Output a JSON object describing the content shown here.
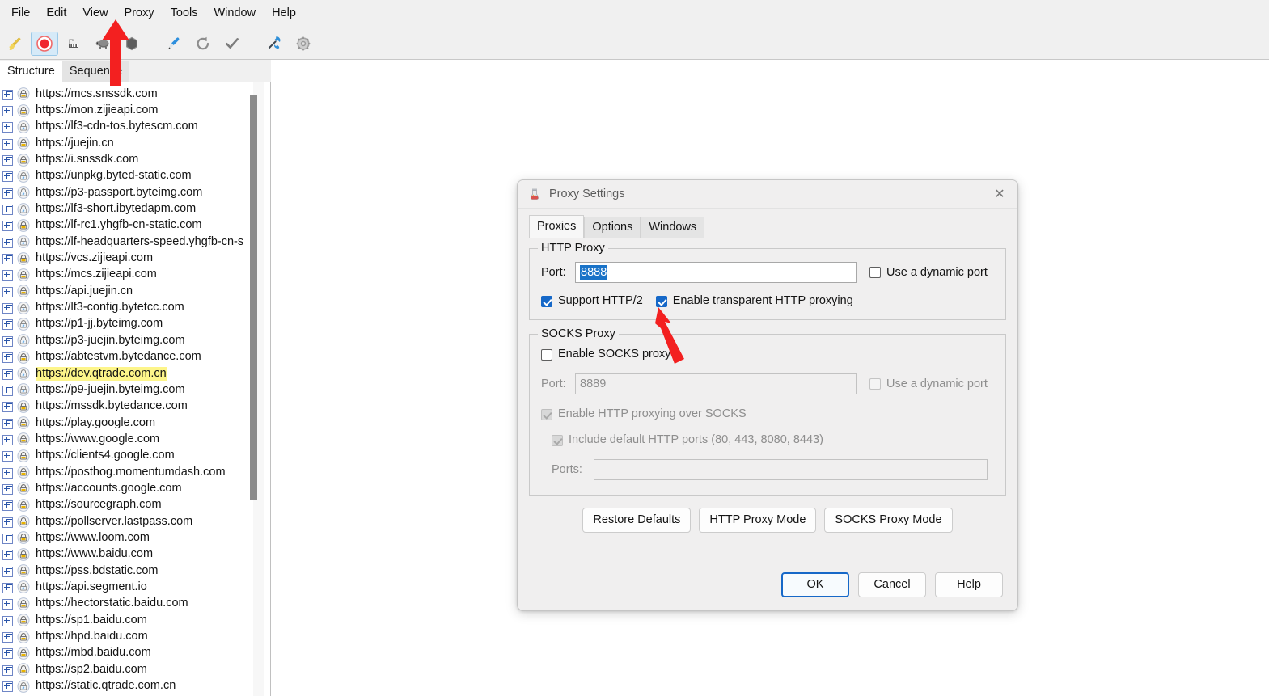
{
  "app": {
    "menubar": [
      "File",
      "Edit",
      "View",
      "Proxy",
      "Tools",
      "Window",
      "Help"
    ],
    "toolbar_icons": [
      "broom-clear-icon",
      "record-icon",
      "breakpoint-icon",
      "throttle-turtle-icon",
      "stop-hexagon-icon",
      "compose-pen-icon",
      "repeat-refresh-icon",
      "validate-check-icon",
      "tools-icon",
      "settings-gear-icon"
    ]
  },
  "left_panel": {
    "tabs": [
      {
        "label": "Structure",
        "active": true
      },
      {
        "label": "Sequence",
        "active": false
      }
    ],
    "items": [
      {
        "label": "https://mcs.snssdk.com",
        "icon": "lock-icon",
        "highlight": false
      },
      {
        "label": "https://mon.zijieapi.com",
        "icon": "lock-icon",
        "highlight": false
      },
      {
        "label": "https://lf3-cdn-tos.bytescm.com",
        "icon": "lock-bolt-icon",
        "highlight": false
      },
      {
        "label": "https://juejin.cn",
        "icon": "lock-icon",
        "highlight": false
      },
      {
        "label": "https://i.snssdk.com",
        "icon": "lock-icon",
        "highlight": false
      },
      {
        "label": "https://unpkg.byted-static.com",
        "icon": "lock-bolt-icon",
        "highlight": false
      },
      {
        "label": "https://p3-passport.byteimg.com",
        "icon": "lock-bolt-icon",
        "highlight": false
      },
      {
        "label": "https://lf3-short.ibytedapm.com",
        "icon": "lock-bolt-icon",
        "highlight": false
      },
      {
        "label": "https://lf-rc1.yhgfb-cn-static.com",
        "icon": "lock-icon",
        "highlight": false
      },
      {
        "label": "https://lf-headquarters-speed.yhgfb-cn-s",
        "icon": "lock-bolt-icon",
        "highlight": false
      },
      {
        "label": "https://vcs.zijieapi.com",
        "icon": "lock-icon",
        "highlight": false
      },
      {
        "label": "https://mcs.zijieapi.com",
        "icon": "lock-icon",
        "highlight": false
      },
      {
        "label": "https://api.juejin.cn",
        "icon": "lock-icon",
        "highlight": false
      },
      {
        "label": "https://lf3-config.bytetcc.com",
        "icon": "lock-bolt-icon",
        "highlight": false
      },
      {
        "label": "https://p1-jj.byteimg.com",
        "icon": "lock-bolt-icon",
        "highlight": false
      },
      {
        "label": "https://p3-juejin.byteimg.com",
        "icon": "lock-bolt-icon",
        "highlight": false
      },
      {
        "label": "https://abtestvm.bytedance.com",
        "icon": "lock-icon",
        "highlight": false
      },
      {
        "label": "https://dev.qtrade.com.cn",
        "icon": "lock-bolt-icon",
        "highlight": true
      },
      {
        "label": "https://p9-juejin.byteimg.com",
        "icon": "lock-bolt-icon",
        "highlight": false
      },
      {
        "label": "https://mssdk.bytedance.com",
        "icon": "lock-icon",
        "highlight": false
      },
      {
        "label": "https://play.google.com",
        "icon": "lock-icon",
        "highlight": false
      },
      {
        "label": "https://www.google.com",
        "icon": "lock-icon",
        "highlight": false
      },
      {
        "label": "https://clients4.google.com",
        "icon": "lock-icon",
        "highlight": false
      },
      {
        "label": "https://posthog.momentumdash.com",
        "icon": "lock-icon",
        "highlight": false
      },
      {
        "label": "https://accounts.google.com",
        "icon": "lock-icon",
        "highlight": false
      },
      {
        "label": "https://sourcegraph.com",
        "icon": "lock-icon",
        "highlight": false
      },
      {
        "label": "https://pollserver.lastpass.com",
        "icon": "lock-icon",
        "highlight": false
      },
      {
        "label": "https://www.loom.com",
        "icon": "lock-icon",
        "highlight": false
      },
      {
        "label": "https://www.baidu.com",
        "icon": "lock-icon",
        "highlight": false
      },
      {
        "label": "https://pss.bdstatic.com",
        "icon": "lock-icon",
        "highlight": false
      },
      {
        "label": "https://api.segment.io",
        "icon": "lock-bolt-icon",
        "highlight": false
      },
      {
        "label": "https://hectorstatic.baidu.com",
        "icon": "lock-icon",
        "highlight": false
      },
      {
        "label": "https://sp1.baidu.com",
        "icon": "lock-icon",
        "highlight": false
      },
      {
        "label": "https://hpd.baidu.com",
        "icon": "lock-icon",
        "highlight": false
      },
      {
        "label": "https://mbd.baidu.com",
        "icon": "lock-icon",
        "highlight": false
      },
      {
        "label": "https://sp2.baidu.com",
        "icon": "lock-icon",
        "highlight": false
      },
      {
        "label": "https://static.qtrade.com.cn",
        "icon": "lock-bolt-icon",
        "highlight": false
      }
    ]
  },
  "dialog": {
    "title": "Proxy Settings",
    "title_icon": "charles-proxy-icon",
    "close_label": "✕",
    "tabs": [
      {
        "label": "Proxies",
        "active": true
      },
      {
        "label": "Options",
        "active": false
      },
      {
        "label": "Windows",
        "active": false
      }
    ],
    "http_proxy": {
      "legend": "HTTP Proxy",
      "port_label": "Port:",
      "port_value": "8888",
      "port_selected": true,
      "dynamic_port_label": "Use a dynamic port",
      "dynamic_port_checked": false,
      "support_http2_label": "Support HTTP/2",
      "support_http2_checked": true,
      "transparent_label": "Enable transparent HTTP proxying",
      "transparent_checked": true
    },
    "socks_proxy": {
      "legend": "SOCKS Proxy",
      "enable_label": "Enable SOCKS proxy",
      "enable_checked": false,
      "port_label": "Port:",
      "port_value": "8889",
      "port_disabled": true,
      "dynamic_port_label": "Use a dynamic port",
      "dynamic_port_checked": false,
      "http_over_socks_label": "Enable HTTP proxying over SOCKS",
      "http_over_socks_checked": true,
      "include_default_label": "Include default HTTP ports (80, 443, 8080, 8443)",
      "include_default_checked": true,
      "ports_label": "Ports:",
      "ports_value": ""
    },
    "mode_buttons": [
      "Restore Defaults",
      "HTTP Proxy Mode",
      "SOCKS Proxy Mode"
    ],
    "footer_buttons": [
      {
        "label": "OK",
        "default": true
      },
      {
        "label": "Cancel",
        "default": false
      },
      {
        "label": "Help",
        "default": false
      }
    ]
  },
  "annotations": {
    "arrows": [
      {
        "name": "arrow-to-proxy-menu",
        "color": "#f32020"
      },
      {
        "name": "arrow-to-transparent-checkbox",
        "color": "#f32020"
      }
    ]
  },
  "colors": {
    "accent": "#1668c8",
    "selection": "#1a73c8",
    "highlight": "#fdf58a",
    "annotation": "#f32020",
    "dialog_bg": "#f0efef",
    "chrome_bg": "#f0f0f0"
  }
}
